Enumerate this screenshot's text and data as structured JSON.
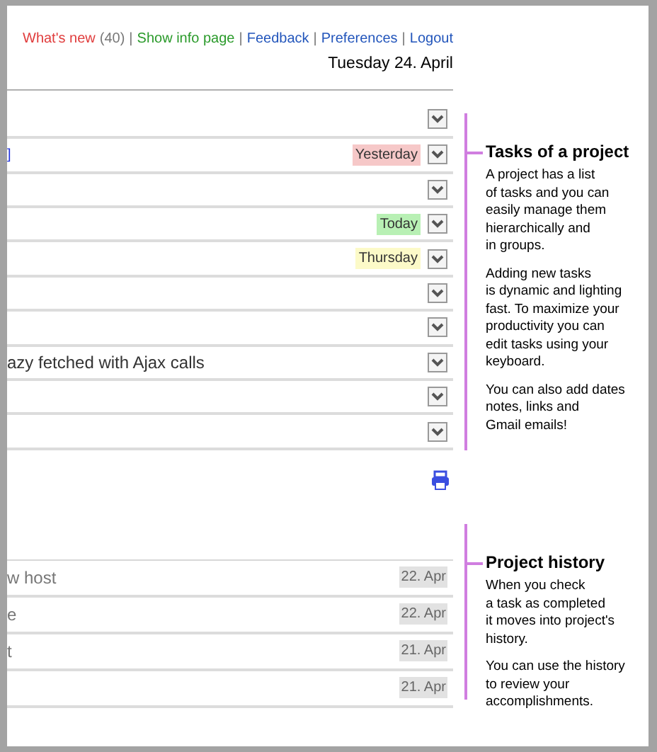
{
  "top_links": [
    {
      "label": "What's new",
      "count": "(40)",
      "color": "#e03c3c"
    },
    {
      "separator": "|",
      "label": "Show info page",
      "color": "#2a9a2a"
    },
    {
      "separator": "|",
      "label": "Feedback",
      "color": "#2255bb"
    },
    {
      "separator": "|",
      "label": "Preferences",
      "color": "#2255bb"
    },
    {
      "separator": "|",
      "label": "Logout",
      "color": "#2255bb"
    }
  ],
  "date": "Tuesday 24. April",
  "tasks": [
    {
      "menu": true
    },
    {
      "text": "]",
      "kind": "link",
      "menu": true,
      "due": {
        "label": "Yesterday",
        "kind": "overdue"
      }
    },
    {
      "menu": true
    },
    {
      "menu": true,
      "due": {
        "label": "Today",
        "kind": "today"
      }
    },
    {
      "menu": true,
      "due": {
        "label": "Thursday",
        "kind": "upcoming"
      }
    },
    {
      "menu": true
    },
    {
      "menu": true
    },
    {
      "text": "azy fetched with Ajax calls",
      "kind": "plain",
      "menu": true
    },
    {
      "menu": true
    },
    {
      "menu": true
    }
  ],
  "history": [
    {
      "text": "w host",
      "date": "22. Apr"
    },
    {
      "text": "e",
      "date": "22. Apr"
    },
    {
      "text": "t",
      "date": "21. Apr"
    },
    {
      "date": "21. Apr"
    }
  ],
  "help": [
    {
      "title": "Tasks of a project",
      "paragraphs": [
        [
          "A project has a list",
          "of tasks and you can",
          "easily manage them",
          "hierarchically and",
          "in groups."
        ],
        [
          "Adding new tasks",
          "is dynamic and lighting",
          "fast. To maximize your",
          "productivity you can",
          "edit tasks using your",
          "keyboard."
        ],
        [
          "You can also add dates",
          "notes, links and",
          "Gmail emails!"
        ]
      ]
    },
    {
      "title": "Project history",
      "paragraphs": [
        [
          "When you check",
          "a task as completed",
          "it moves into project's",
          "history."
        ],
        [
          "You can use the history",
          "to review your",
          "accomplishments."
        ]
      ]
    }
  ]
}
